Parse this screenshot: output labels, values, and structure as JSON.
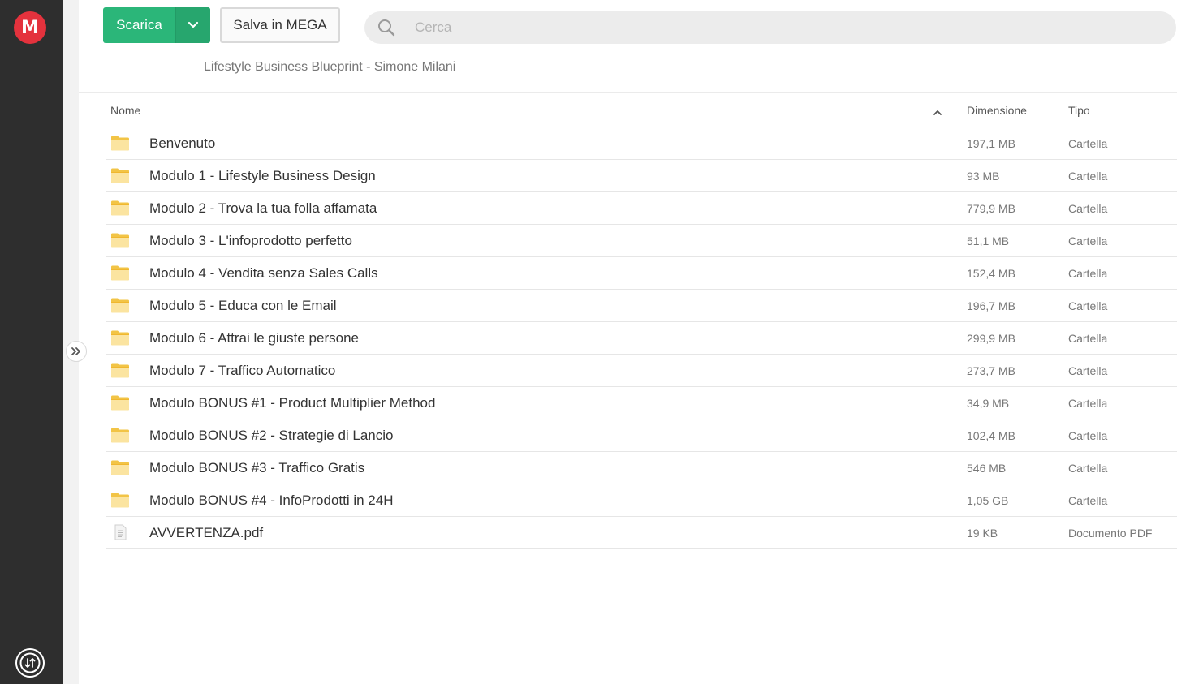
{
  "app": {
    "logo_glyph": "M",
    "accent": "#e4323d",
    "download_color": "#2bb679"
  },
  "toolbar": {
    "download_label": "Scarica",
    "save_label": "Salva in MEGA"
  },
  "search": {
    "placeholder": "Cerca"
  },
  "breadcrumb": {
    "title": "Lifestyle Business Blueprint - Simone Milani"
  },
  "table": {
    "columns": {
      "name": "Nome",
      "size": "Dimensione",
      "type": "Tipo"
    },
    "rows": [
      {
        "icon": "folder-icon",
        "name": "Benvenuto",
        "size": "197,1 MB",
        "type": "Cartella"
      },
      {
        "icon": "folder-icon",
        "name": "Modulo 1 - Lifestyle Business Design",
        "size": "93 MB",
        "type": "Cartella"
      },
      {
        "icon": "folder-icon",
        "name": "Modulo 2 - Trova la tua folla affamata",
        "size": "779,9 MB",
        "type": "Cartella"
      },
      {
        "icon": "folder-icon",
        "name": "Modulo 3 - L'infoprodotto perfetto",
        "size": "51,1 MB",
        "type": "Cartella"
      },
      {
        "icon": "folder-icon",
        "name": "Modulo 4 - Vendita senza Sales Calls",
        "size": "152,4 MB",
        "type": "Cartella"
      },
      {
        "icon": "folder-icon",
        "name": "Modulo 5 - Educa con le Email",
        "size": "196,7 MB",
        "type": "Cartella"
      },
      {
        "icon": "folder-icon",
        "name": "Modulo 6 - Attrai le giuste persone",
        "size": "299,9 MB",
        "type": "Cartella"
      },
      {
        "icon": "folder-icon",
        "name": "Modulo 7 - Traffico Automatico",
        "size": "273,7 MB",
        "type": "Cartella"
      },
      {
        "icon": "folder-icon",
        "name": "Modulo BONUS #1 - Product Multiplier Method",
        "size": "34,9 MB",
        "type": "Cartella"
      },
      {
        "icon": "folder-icon",
        "name": "Modulo BONUS #2 - Strategie di Lancio",
        "size": "102,4 MB",
        "type": "Cartella"
      },
      {
        "icon": "folder-icon",
        "name": "Modulo BONUS #3 - Traffico Gratis",
        "size": "546 MB",
        "type": "Cartella"
      },
      {
        "icon": "folder-icon",
        "name": "Modulo BONUS #4 - InfoProdotti in 24H",
        "size": "1,05 GB",
        "type": "Cartella"
      },
      {
        "icon": "pdf-file-icon",
        "name": "AVVERTENZA.pdf",
        "size": "19 KB",
        "type": "Documento PDF"
      }
    ]
  }
}
